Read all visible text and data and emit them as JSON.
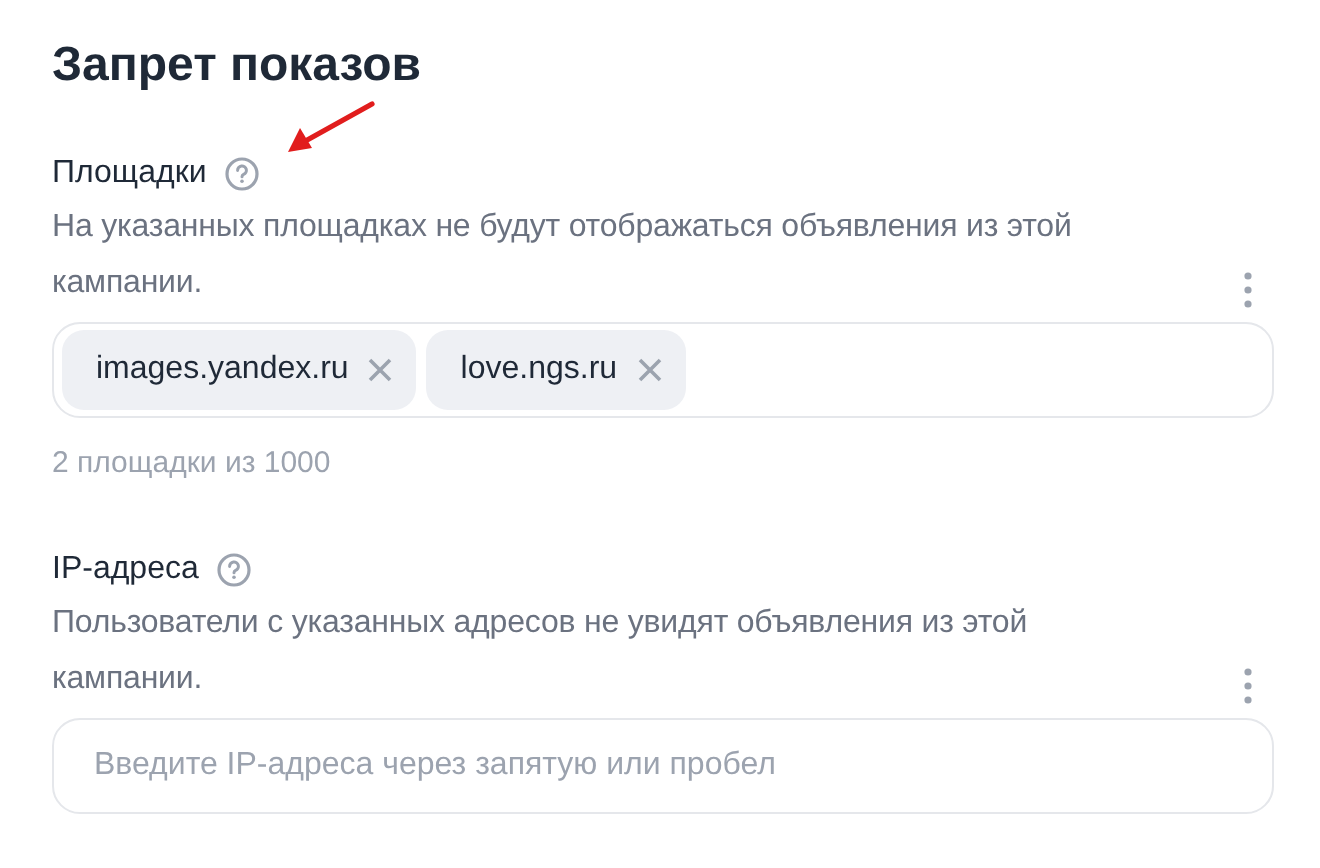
{
  "title": "Запрет показов",
  "sections": [
    {
      "kind": "tags",
      "label": "Площадки",
      "description": "На указанных площадках не будут отображаться объявления из этой кампании.",
      "tags": [
        {
          "text": "images.yandex.ru"
        },
        {
          "text": "love.ngs.ru"
        }
      ],
      "footnote": "2 площадки из 1000",
      "annotated": true
    },
    {
      "kind": "input",
      "label": "IP-адреса",
      "description": "Пользователи с указанных адресов не увидят объявления из этой кампании.",
      "placeholder": "Введите IP-адреса через запятую или пробел",
      "annotated": false
    }
  ]
}
